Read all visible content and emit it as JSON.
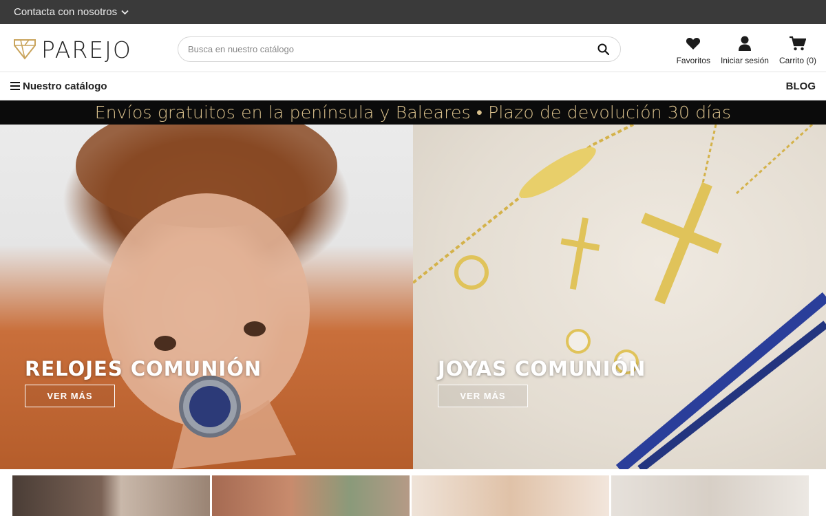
{
  "topbar": {
    "contact_label": "Contacta con nosotros"
  },
  "header": {
    "logo_text": "PAREJO",
    "search": {
      "placeholder": "Busca en nuestro catálogo",
      "value": ""
    },
    "actions": {
      "favorites": "Favoritos",
      "login": "Iniciar sesión",
      "cart": "Carrito (0)"
    }
  },
  "nav": {
    "catalog_label": "Nuestro catálogo",
    "blog_label": "BLOG"
  },
  "promo": {
    "text": "Envíos gratuitos en la península y Baleares • Plazo de devolución 30 días"
  },
  "hero": {
    "left": {
      "title": "RELOJES COMUNIÓN",
      "button": "VER MÁS"
    },
    "right": {
      "title": "JOYAS COMUNIÓN",
      "button": "VER MÁS"
    }
  },
  "colors": {
    "topbar": "#3a3a3a",
    "promo_bg": "#0b0b0b",
    "promo_text": "#d9c08c",
    "logo_gold": "#c9a45c"
  },
  "icons": [
    "chevron-down-icon",
    "logo-mark-icon",
    "search-icon",
    "heart-icon",
    "user-icon",
    "cart-icon",
    "menu-icon"
  ]
}
